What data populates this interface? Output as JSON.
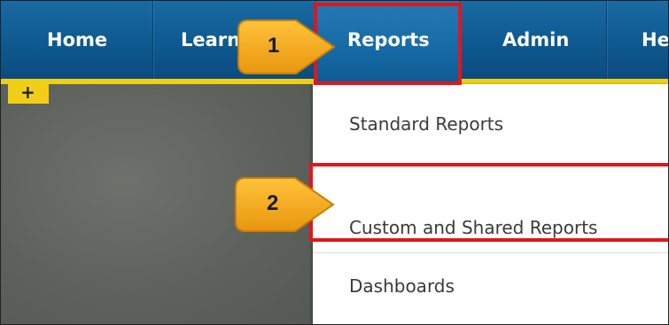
{
  "nav": {
    "items": [
      {
        "label": "Home"
      },
      {
        "label": "Learn"
      },
      {
        "label": "Reports"
      },
      {
        "label": "Admin"
      },
      {
        "label": "He"
      }
    ]
  },
  "panel": {
    "add_label": "+"
  },
  "dropdown": {
    "items": [
      {
        "label": "Standard Reports"
      },
      {
        "label": "Custom and Shared Reports"
      },
      {
        "label": "Dashboards"
      }
    ]
  },
  "callouts": [
    {
      "number": "1"
    },
    {
      "number": "2"
    }
  ],
  "colors": {
    "nav_blue": "#0f5b92",
    "accent_yellow": "#f2cf16",
    "highlight_red": "#e3151c",
    "callout_orange": "#f4a81c"
  }
}
